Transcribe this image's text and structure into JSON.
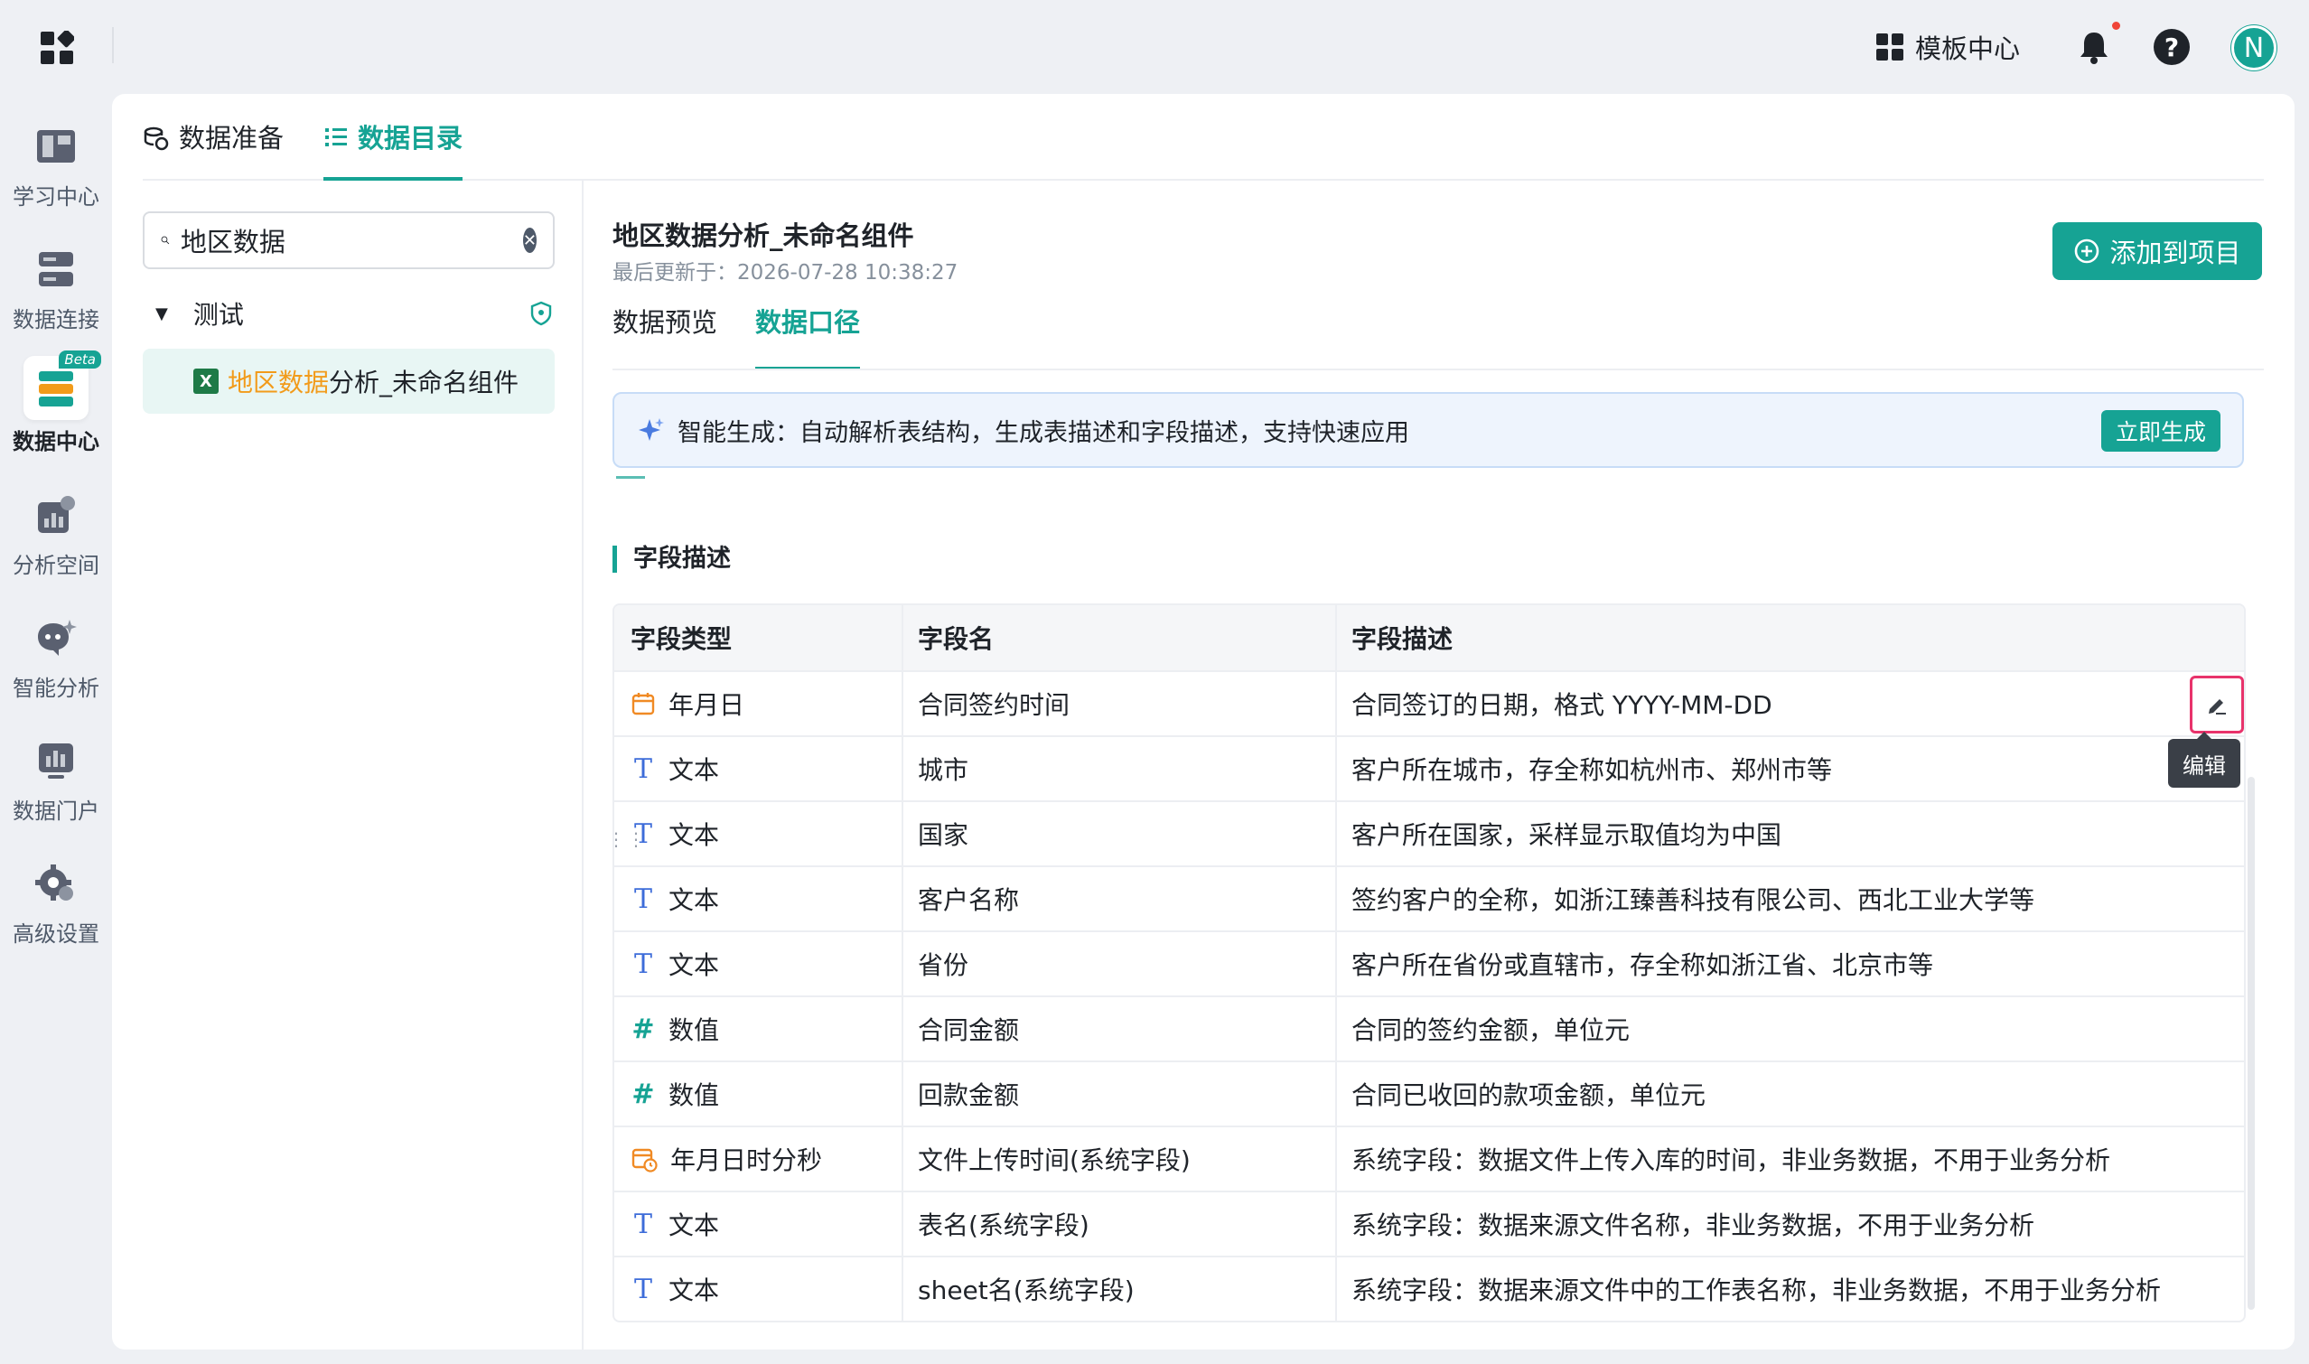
{
  "topbar": {
    "template_center": "模板中心",
    "avatar_letter": "N"
  },
  "rail": {
    "items": [
      {
        "label": "学习中心"
      },
      {
        "label": "数据连接"
      },
      {
        "label": "数据中心",
        "badge": "Beta"
      },
      {
        "label": "分析空间"
      },
      {
        "label": "智能分析"
      },
      {
        "label": "数据门户"
      },
      {
        "label": "高级设置"
      }
    ]
  },
  "top_tabs": [
    {
      "label": "数据准备"
    },
    {
      "label": "数据目录"
    }
  ],
  "tree": {
    "search_value": "地区数据",
    "folder_name": "测试",
    "file_highlight": "地区数据",
    "file_rest": "分析_未命名组件"
  },
  "content": {
    "title": "地区数据分析_未命名组件",
    "updated": "最后更新于：2026-07-28 10:38:27",
    "add_button": "添加到项目",
    "sub_tabs": [
      {
        "label": "数据预览"
      },
      {
        "label": "数据口径"
      }
    ],
    "ai_banner": {
      "text": "智能生成：自动解析表结构，生成表描述和字段描述，支持快速应用",
      "button": "立即生成"
    },
    "section_title": "字段描述",
    "table": {
      "headers": [
        "字段类型",
        "字段名",
        "字段描述"
      ],
      "rows": [
        {
          "type": "年月日",
          "icon": "calendar-icon",
          "name": "合同签约时间",
          "desc": "合同签订的日期，格式 YYYY-MM-DD"
        },
        {
          "type": "文本",
          "icon": "text-type-icon",
          "name": "城市",
          "desc": "客户所在城市，存全称如杭州市、郑州市等"
        },
        {
          "type": "文本",
          "icon": "text-type-icon",
          "name": "国家",
          "desc": "客户所在国家，采样显示取值均为中国"
        },
        {
          "type": "文本",
          "icon": "text-type-icon",
          "name": "客户名称",
          "desc": "签约客户的全称，如浙江臻善科技有限公司、西北工业大学等"
        },
        {
          "type": "文本",
          "icon": "text-type-icon",
          "name": "省份",
          "desc": "客户所在省份或直辖市，存全称如浙江省、北京市等"
        },
        {
          "type": "数值",
          "icon": "number-type-icon",
          "name": "合同金额",
          "desc": "合同的签约金额，单位元"
        },
        {
          "type": "数值",
          "icon": "number-type-icon",
          "name": "回款金额",
          "desc": "合同已收回的款项金额，单位元"
        },
        {
          "type": "年月日时分秒",
          "icon": "datetime-icon",
          "name": "文件上传时间(系统字段)",
          "desc": "系统字段：数据文件上传入库的时间，非业务数据，不用于业务分析"
        },
        {
          "type": "文本",
          "icon": "text-type-icon",
          "name": "表名(系统字段)",
          "desc": "系统字段：数据来源文件名称，非业务数据，不用于业务分析"
        },
        {
          "type": "文本",
          "icon": "text-type-icon",
          "name": "sheet名(系统字段)",
          "desc": "系统字段：数据来源文件中的工作表名称，非业务数据，不用于业务分析"
        }
      ]
    },
    "edit_tooltip": "编辑"
  },
  "colors": {
    "accent": "#16a394",
    "highlight": "#f29b1a",
    "edit_border": "#e8336b"
  }
}
